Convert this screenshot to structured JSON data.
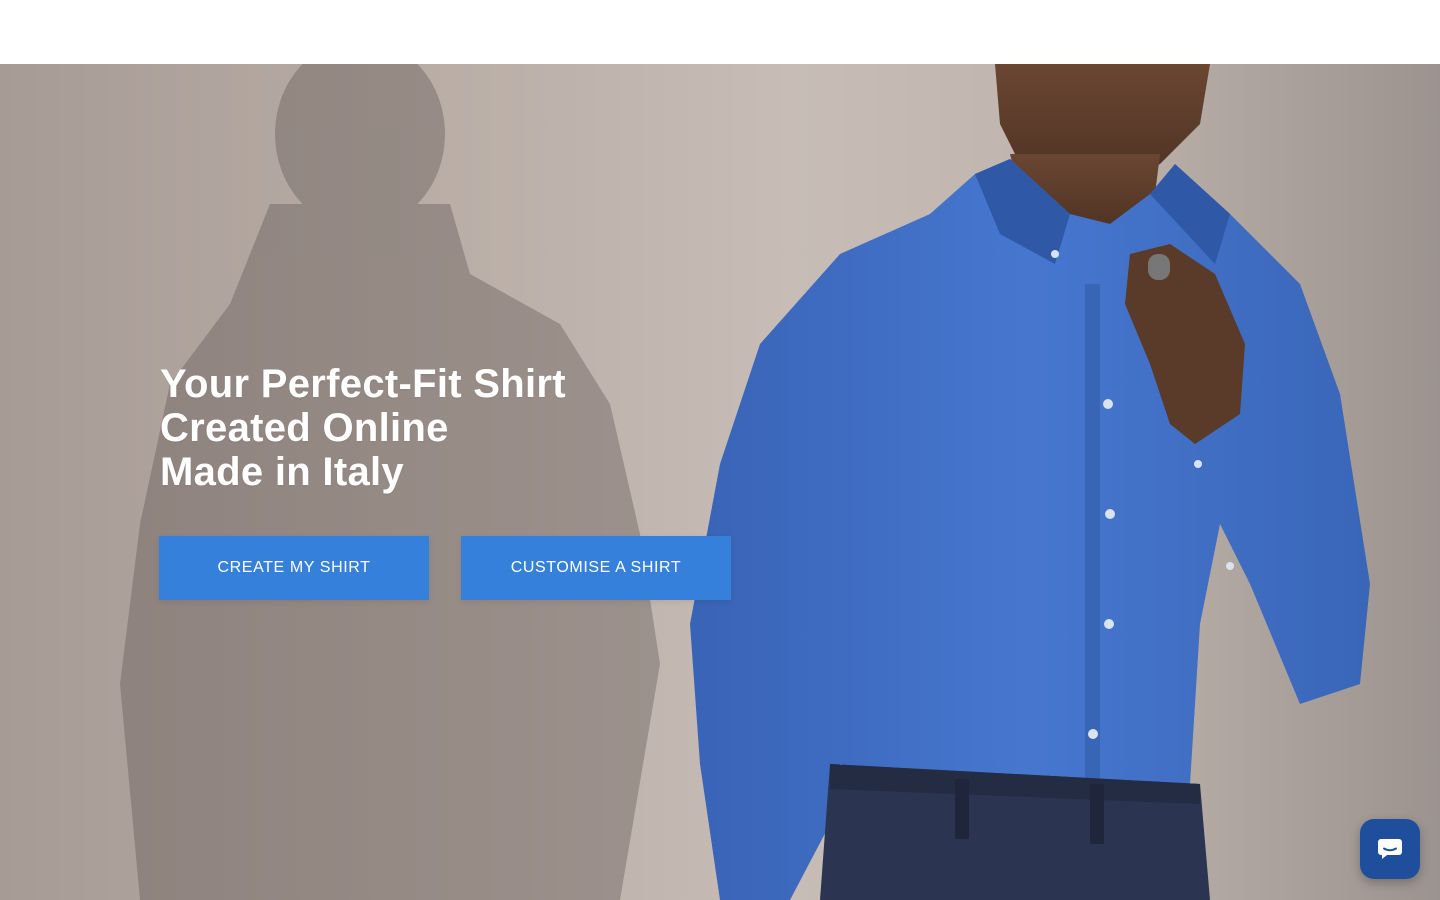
{
  "hero": {
    "headline_lines": [
      "Your Perfect-Fit Shirt",
      "Created Online",
      "Made in Italy"
    ],
    "primary_cta": "CREATE MY SHIRT",
    "secondary_cta": "CUSTOMISE A SHIRT",
    "image_subject": "man-in-blue-shirt-with-shadow"
  },
  "chat_widget": {
    "icon": "chat-bubble-icon"
  },
  "colors": {
    "cta_background": "#3580db",
    "chat_background": "#1f4f9c",
    "shirt_blue": "#3f6fc3",
    "background_wall": "#c2b7b0"
  }
}
